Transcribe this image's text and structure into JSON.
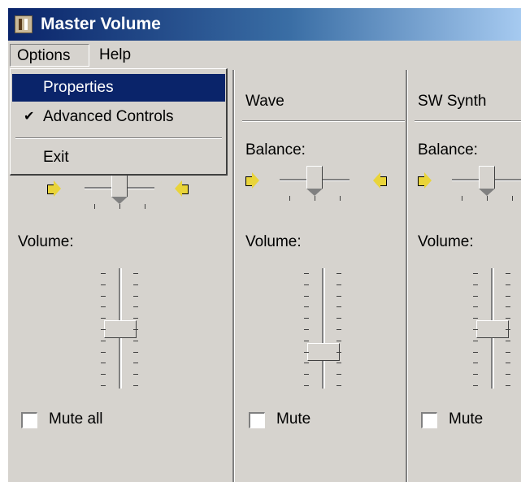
{
  "window": {
    "title": "Master Volume"
  },
  "menubar": {
    "items": [
      {
        "label": "Options"
      },
      {
        "label": "Help"
      }
    ]
  },
  "options_menu": {
    "items": [
      {
        "label": "Properties",
        "highlighted": true
      },
      {
        "label": "Advanced Controls",
        "checked": true
      },
      {
        "label": "Exit"
      }
    ]
  },
  "channels": [
    {
      "title": "",
      "balance_label": "",
      "balance_value": 0,
      "volume_label": "Volume:",
      "volume_level": 0.5,
      "mute_label": "Mute all",
      "muted": false
    },
    {
      "title": "Wave",
      "balance_label": "Balance:",
      "balance_value": 0,
      "volume_label": "Volume:",
      "volume_level": 0.28,
      "mute_label": "Mute",
      "muted": false
    },
    {
      "title": "SW Synth",
      "balance_label": "Balance:",
      "balance_value": 0,
      "volume_label": "Volume:",
      "volume_level": 0.5,
      "mute_label": "Mute",
      "muted": false
    }
  ],
  "icons": {
    "title_icon": "volume-control-icon",
    "speaker_left": "left-speaker-icon",
    "speaker_right": "right-speaker-icon",
    "check_mark": "check-mark-icon"
  },
  "colors": {
    "title_bar": "#0a246a",
    "window_bg": "#d6d3ce",
    "menu_highlight": "#0a246a",
    "speaker": "#e9d43a"
  }
}
